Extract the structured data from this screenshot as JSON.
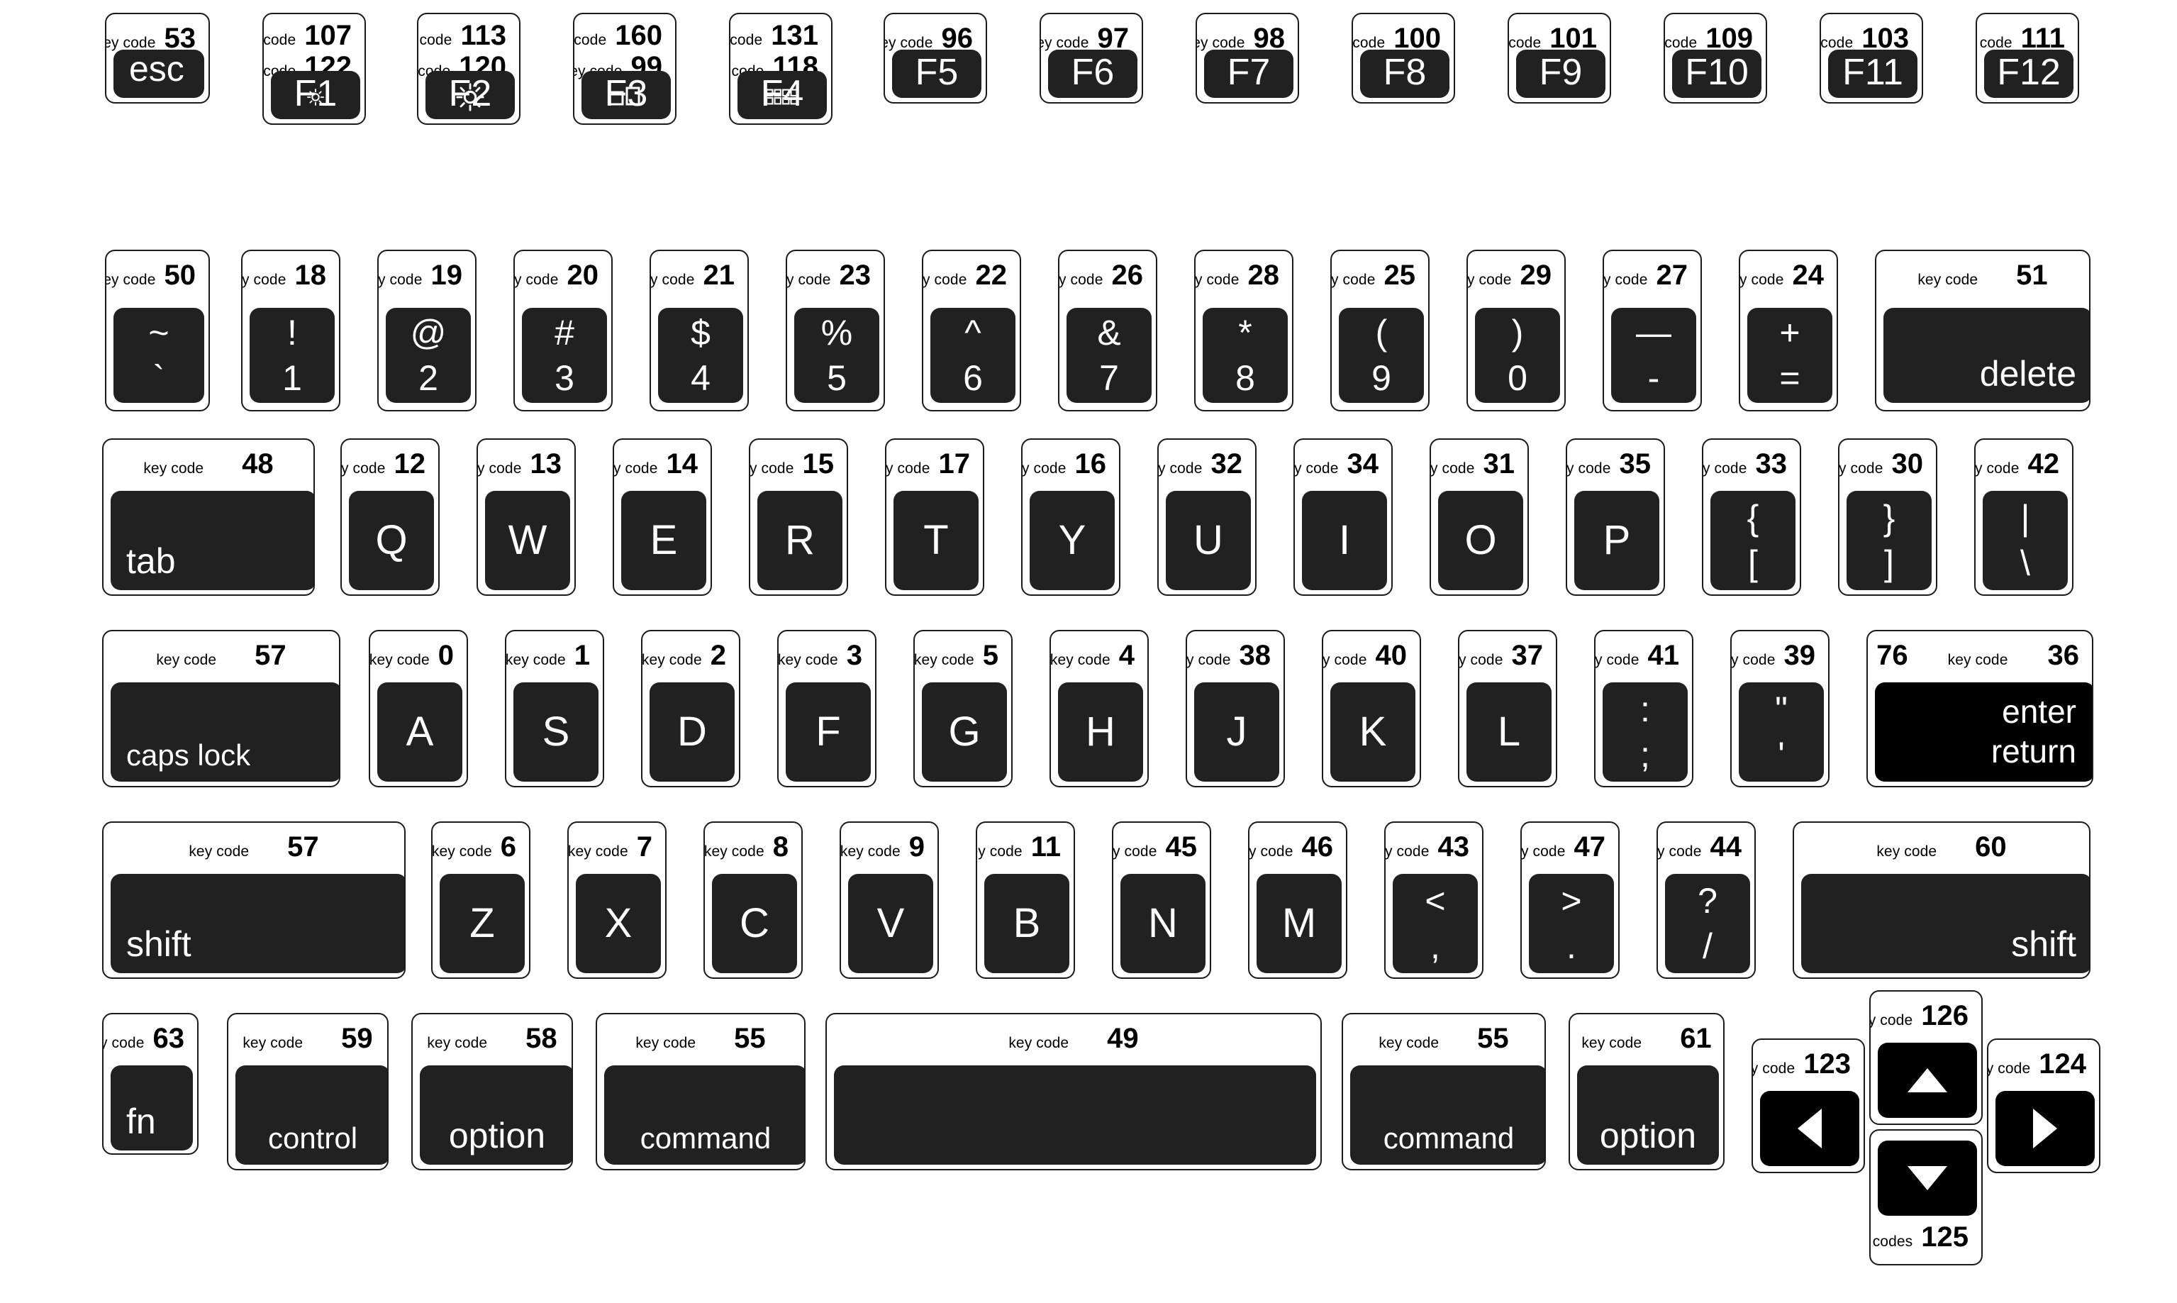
{
  "meta": {
    "code_label": "key code",
    "codes_label_plural": "key codes"
  },
  "rows": {
    "function_row": [
      {
        "name": "esc",
        "codes": [
          "53"
        ],
        "label": "esc",
        "label_style": "bottom-left"
      },
      {
        "name": "f1",
        "codes": [
          "107",
          "122"
        ],
        "label": "F1",
        "icon": "brightness-down-icon",
        "label_style": "fkey"
      },
      {
        "name": "f2",
        "codes": [
          "113",
          "120"
        ],
        "label": "F2",
        "icon": "brightness-up-icon",
        "label_style": "fkey"
      },
      {
        "name": "f3",
        "codes": [
          "160",
          "99"
        ],
        "label": "F3",
        "icon": "mission-control-icon",
        "label_style": "fkey"
      },
      {
        "name": "f4",
        "codes": [
          "131",
          "118"
        ],
        "label": "F4",
        "icon": "launchpad-icon",
        "label_style": "fkey"
      },
      {
        "name": "f5",
        "codes": [
          "96"
        ],
        "label": "F5",
        "label_style": "fkey"
      },
      {
        "name": "f6",
        "codes": [
          "97"
        ],
        "label": "F6",
        "label_style": "fkey"
      },
      {
        "name": "f7",
        "codes": [
          "98"
        ],
        "label": "F7",
        "label_style": "fkey"
      },
      {
        "name": "f8",
        "codes": [
          "100"
        ],
        "label": "F8",
        "label_style": "fkey"
      },
      {
        "name": "f9",
        "codes": [
          "101"
        ],
        "label": "F9",
        "label_style": "fkey"
      },
      {
        "name": "f10",
        "codes": [
          "109"
        ],
        "label": "F10",
        "label_style": "fkey"
      },
      {
        "name": "f11",
        "codes": [
          "103"
        ],
        "label": "F11",
        "label_style": "fkey"
      },
      {
        "name": "f12",
        "codes": [
          "111"
        ],
        "label": "F12",
        "label_style": "fkey"
      }
    ],
    "number_row": [
      {
        "name": "grave",
        "codes": [
          "50"
        ],
        "upper": "~",
        "lower": "`"
      },
      {
        "name": "1",
        "codes": [
          "18"
        ],
        "upper": "!",
        "lower": "1"
      },
      {
        "name": "2",
        "codes": [
          "19"
        ],
        "upper": "@",
        "lower": "2"
      },
      {
        "name": "3",
        "codes": [
          "20"
        ],
        "upper": "#",
        "lower": "3"
      },
      {
        "name": "4",
        "codes": [
          "21"
        ],
        "upper": "$",
        "lower": "4"
      },
      {
        "name": "5",
        "codes": [
          "23"
        ],
        "upper": "%",
        "lower": "5"
      },
      {
        "name": "6",
        "codes": [
          "22"
        ],
        "upper": "^",
        "lower": "6"
      },
      {
        "name": "7",
        "codes": [
          "26"
        ],
        "upper": "&",
        "lower": "7"
      },
      {
        "name": "8",
        "codes": [
          "28"
        ],
        "upper": "*",
        "lower": "8"
      },
      {
        "name": "9",
        "codes": [
          "25"
        ],
        "upper": "(",
        "lower": "9"
      },
      {
        "name": "0",
        "codes": [
          "29"
        ],
        "upper": ")",
        "lower": "0"
      },
      {
        "name": "minus",
        "codes": [
          "27"
        ],
        "upper": "—",
        "lower": "-"
      },
      {
        "name": "equal",
        "codes": [
          "24"
        ],
        "upper": "+",
        "lower": "="
      },
      {
        "name": "delete",
        "codes": [
          "51"
        ],
        "label": "delete",
        "label_style": "bottom-right"
      }
    ],
    "top_row": [
      {
        "name": "tab",
        "codes": [
          "48"
        ],
        "label": "tab",
        "label_style": "bottom-left"
      },
      {
        "name": "q",
        "codes": [
          "12"
        ],
        "label": "Q",
        "label_style": "center"
      },
      {
        "name": "w",
        "codes": [
          "13"
        ],
        "label": "W",
        "label_style": "center"
      },
      {
        "name": "e",
        "codes": [
          "14"
        ],
        "label": "E",
        "label_style": "center"
      },
      {
        "name": "r",
        "codes": [
          "15"
        ],
        "label": "R",
        "label_style": "center"
      },
      {
        "name": "t",
        "codes": [
          "17"
        ],
        "label": "T",
        "label_style": "center"
      },
      {
        "name": "y",
        "codes": [
          "16"
        ],
        "label": "Y",
        "label_style": "center"
      },
      {
        "name": "u",
        "codes": [
          "32"
        ],
        "label": "U",
        "label_style": "center"
      },
      {
        "name": "i",
        "codes": [
          "34"
        ],
        "label": "I",
        "label_style": "center"
      },
      {
        "name": "o",
        "codes": [
          "31"
        ],
        "label": "O",
        "label_style": "center"
      },
      {
        "name": "p",
        "codes": [
          "35"
        ],
        "label": "P",
        "label_style": "center"
      },
      {
        "name": "bracket-left",
        "codes": [
          "33"
        ],
        "upper": "{",
        "lower": "["
      },
      {
        "name": "bracket-right",
        "codes": [
          "30"
        ],
        "upper": "}",
        "lower": "]"
      },
      {
        "name": "backslash",
        "codes": [
          "42"
        ],
        "upper": "|",
        "lower": "\\"
      }
    ],
    "home_row": [
      {
        "name": "caps-lock",
        "codes": [
          "57"
        ],
        "label": "caps lock",
        "label_style": "bottom-left"
      },
      {
        "name": "a",
        "codes": [
          "0"
        ],
        "label": "A",
        "label_style": "center"
      },
      {
        "name": "s",
        "codes": [
          "1"
        ],
        "label": "S",
        "label_style": "center"
      },
      {
        "name": "d",
        "codes": [
          "2"
        ],
        "label": "D",
        "label_style": "center"
      },
      {
        "name": "f",
        "codes": [
          "3"
        ],
        "label": "F",
        "label_style": "center"
      },
      {
        "name": "g",
        "codes": [
          "5"
        ],
        "label": "G",
        "label_style": "center"
      },
      {
        "name": "h",
        "codes": [
          "4"
        ],
        "label": "H",
        "label_style": "center"
      },
      {
        "name": "j",
        "codes": [
          "38"
        ],
        "label": "J",
        "label_style": "center"
      },
      {
        "name": "k",
        "codes": [
          "40"
        ],
        "label": "K",
        "label_style": "center"
      },
      {
        "name": "l",
        "codes": [
          "37"
        ],
        "label": "L",
        "label_style": "center"
      },
      {
        "name": "semicolon",
        "codes": [
          "41"
        ],
        "upper": ":",
        "lower": ";"
      },
      {
        "name": "quote",
        "codes": [
          "39"
        ],
        "upper": "\"",
        "lower": "'"
      },
      {
        "name": "enter-return",
        "codes": [
          "76",
          "36"
        ],
        "lines": [
          "enter",
          "return"
        ],
        "label_style": "stack-right"
      }
    ],
    "shift_row": [
      {
        "name": "shift-left",
        "codes": [
          "57"
        ],
        "label": "shift",
        "label_style": "bottom-left"
      },
      {
        "name": "z",
        "codes": [
          "6"
        ],
        "label": "Z",
        "label_style": "center"
      },
      {
        "name": "x",
        "codes": [
          "7"
        ],
        "label": "X",
        "label_style": "center"
      },
      {
        "name": "c",
        "codes": [
          "8"
        ],
        "label": "C",
        "label_style": "center"
      },
      {
        "name": "v",
        "codes": [
          "9"
        ],
        "label": "V",
        "label_style": "center"
      },
      {
        "name": "b",
        "codes": [
          "11"
        ],
        "label": "B",
        "label_style": "center"
      },
      {
        "name": "n",
        "codes": [
          "45"
        ],
        "label": "N",
        "label_style": "center"
      },
      {
        "name": "m",
        "codes": [
          "46"
        ],
        "label": "M",
        "label_style": "center"
      },
      {
        "name": "comma",
        "codes": [
          "43"
        ],
        "upper": "<",
        "lower": ","
      },
      {
        "name": "period",
        "codes": [
          "47"
        ],
        "upper": ">",
        "lower": "."
      },
      {
        "name": "slash",
        "codes": [
          "44"
        ],
        "upper": "?",
        "lower": "/"
      },
      {
        "name": "shift-right",
        "codes": [
          "60"
        ],
        "label": "shift",
        "label_style": "bottom-right"
      }
    ],
    "bottom_row": [
      {
        "name": "fn",
        "codes": [
          "63"
        ],
        "label": "fn",
        "label_style": "bottom-left"
      },
      {
        "name": "control",
        "codes": [
          "59"
        ],
        "label": "control",
        "label_style": "bottom-center"
      },
      {
        "name": "option-left",
        "codes": [
          "58"
        ],
        "label": "option",
        "label_style": "bottom-center"
      },
      {
        "name": "command-left",
        "codes": [
          "55"
        ],
        "label": "command",
        "label_style": "bottom-center"
      },
      {
        "name": "space",
        "codes": [
          "49"
        ],
        "label": "",
        "label_style": "none"
      },
      {
        "name": "command-right",
        "codes": [
          "55"
        ],
        "label": "command",
        "label_style": "bottom-center"
      },
      {
        "name": "option-right",
        "codes": [
          "61"
        ],
        "label": "option",
        "label_style": "bottom-center"
      }
    ],
    "arrow_cluster": [
      {
        "name": "arrow-left",
        "codes": [
          "123"
        ],
        "icon": "arrow-left-icon",
        "code_position": "top"
      },
      {
        "name": "arrow-up",
        "codes": [
          "126"
        ],
        "icon": "arrow-up-icon",
        "code_position": "top"
      },
      {
        "name": "arrow-down",
        "codes": [
          "125"
        ],
        "icon": "arrow-down-icon",
        "code_position": "bottom",
        "code_label_override": "key codes"
      },
      {
        "name": "arrow-right",
        "codes": [
          "124"
        ],
        "icon": "arrow-right-icon",
        "code_position": "top"
      }
    ]
  },
  "colors": {
    "keycap": "#212121",
    "keycap_alt": "#000000",
    "card_border": "#1b1b1b",
    "background": "#ffffff",
    "label": "#ffffff",
    "code_text": "#000000"
  }
}
